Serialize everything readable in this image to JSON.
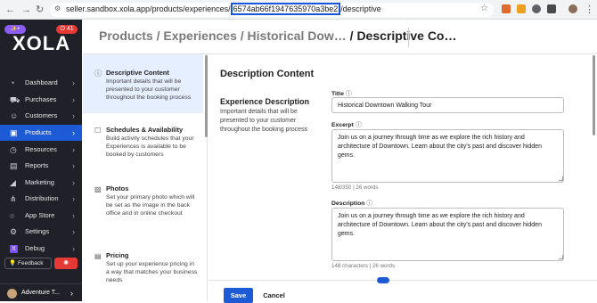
{
  "browser": {
    "url_prefix": "seller.sandbox.xola.app/products/experiences/",
    "url_id": "6574ab66f1947635970a3be2",
    "url_suffix": "/descriptive"
  },
  "sidebar": {
    "brand": "XOLA",
    "pill_left": "✨+",
    "pill_right": "⏻ 41",
    "items": [
      {
        "label": "Dashboard",
        "icon": "gauge-icon"
      },
      {
        "label": "Purchases",
        "icon": "cart-icon"
      },
      {
        "label": "Customers",
        "icon": "users-icon"
      },
      {
        "label": "Products",
        "icon": "box-icon"
      },
      {
        "label": "Resources",
        "icon": "clock-icon"
      },
      {
        "label": "Reports",
        "icon": "chart-icon"
      },
      {
        "label": "Marketing",
        "icon": "megaphone-icon"
      },
      {
        "label": "Distribution",
        "icon": "network-icon"
      },
      {
        "label": "App Store",
        "icon": "store-icon"
      },
      {
        "label": "Settings",
        "icon": "gear-icon"
      },
      {
        "label": "Debug",
        "icon": "x-logo-icon"
      }
    ],
    "active_item": "Products",
    "feedback": "Feedback",
    "account": "Adventure T..."
  },
  "breadcrumb": {
    "part1": "Products /",
    "part2": "Experiences /",
    "part3": "Historical Dow…",
    "current": "/ Descriptive Co…"
  },
  "steps": [
    {
      "title": "Descriptive Content",
      "desc": "Important details that will be presented to your customer throughout the booking process",
      "icon": "info-icon"
    },
    {
      "title": "Schedules & Availability",
      "desc": "Build activity schedules that your Experiences is available to be booked by customers",
      "icon": "calendar-icon"
    },
    {
      "title": "Photos",
      "desc": "Set your primary photo which will be set as the image in the back office and in online checkout",
      "icon": "image-icon"
    },
    {
      "title": "Pricing",
      "desc": "Set up your experience pricing in a way that matches your business needs",
      "icon": "pricing-icon"
    }
  ],
  "main": {
    "section_title": "Description Content",
    "group_title": "Experience Description",
    "group_desc": "Important details that will be presented to your customer throughout the booking process",
    "title_label": "Title",
    "title_value": "Historical Downtown Walking Tour",
    "excerpt_label": "Excerpt",
    "excerpt_value": "Join us on a journey through time as we explore the rich history and architecture of Downtown. Learn about the city's past and discover hidden gems.",
    "excerpt_count": "148/350  |  26 words",
    "description_label": "Description",
    "description_value": "Join us on a journey through time as we explore the rich history and architecture of Downtown. Learn about the city's past and discover hidden gems.",
    "description_count": "148 characters  |  26 words"
  },
  "footer": {
    "save": "Save",
    "cancel": "Cancel"
  },
  "colors": {
    "accent": "#1d5bd6",
    "sidebar_bg": "#1f2028",
    "highlight": "#1a56db",
    "badge_red": "#e53935"
  }
}
